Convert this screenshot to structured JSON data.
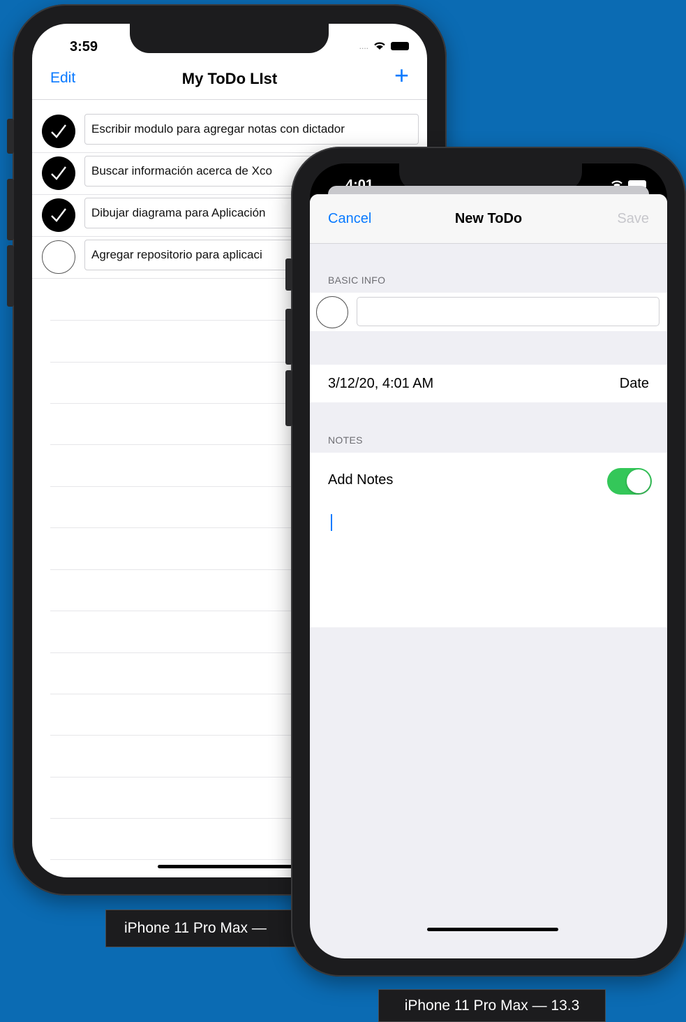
{
  "device_list": {
    "status_time": "3:59",
    "nav": {
      "edit_label": "Edit",
      "title": "My ToDo LIst",
      "add_symbol": "+"
    },
    "todos": [
      {
        "text": "Escribir modulo para agregar notas con dictador",
        "done": true
      },
      {
        "text": "Buscar información acerca de Xco",
        "done": true
      },
      {
        "text": "Dibujar diagrama para Aplicación",
        "done": true
      },
      {
        "text": "Agregar repositorio para aplicaci",
        "done": false
      }
    ],
    "label": "iPhone 11 Pro Max —"
  },
  "device_new": {
    "status_time": "4:01",
    "nav": {
      "cancel_label": "Cancel",
      "title": "New ToDo",
      "save_label": "Save"
    },
    "sections": {
      "basic_info_header": "BASIC INFO",
      "notes_header": "NOTES"
    },
    "title_input_value": "",
    "date_value": "3/12/20, 4:01 AM",
    "date_label": "Date",
    "add_notes_label": "Add Notes",
    "add_notes_enabled": true,
    "label": "iPhone 11 Pro Max — 13.3"
  },
  "colors": {
    "background": "#0b6bb3",
    "tint": "#0a7aff",
    "toggle_on": "#34c759",
    "disabled": "#c7c7cc"
  },
  "icons": [
    "checkmark-icon",
    "wifi-icon",
    "battery-icon",
    "plus-icon"
  ]
}
